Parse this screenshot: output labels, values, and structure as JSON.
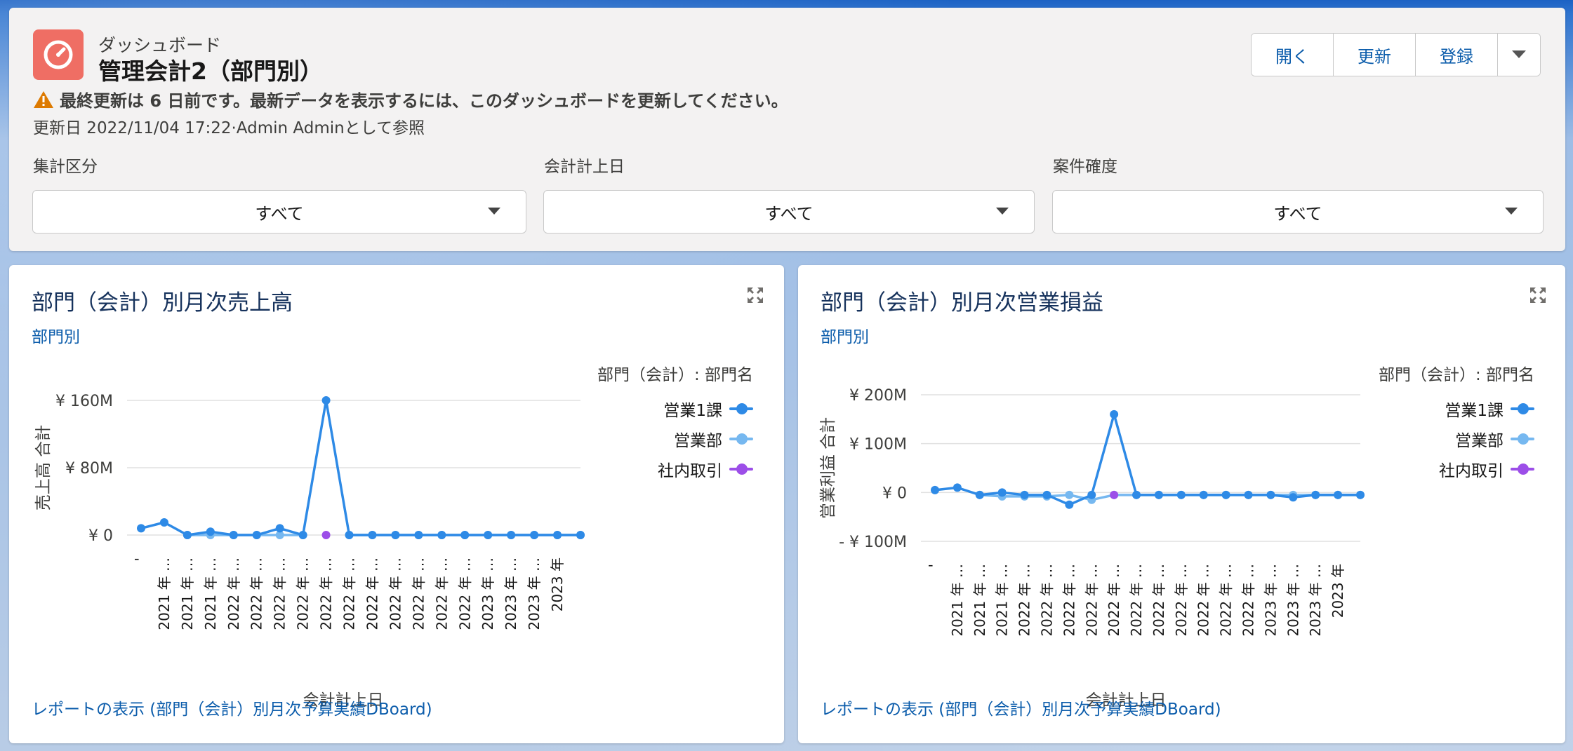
{
  "header": {
    "eyebrow": "ダッシュボード",
    "title": "管理会計2（部門別）",
    "warning": "最終更新は 6 日前です。最新データを表示するには、このダッシュボードを更新してください。",
    "updated": "更新日 2022/11/04 17:22·Admin Adminとして参照",
    "buttons": {
      "open": "開く",
      "refresh": "更新",
      "subscribe": "登録"
    },
    "icon": "dashboard-gauge-icon",
    "icon_color": "#ef6e64"
  },
  "filters": [
    {
      "label": "集計区分",
      "value": "すべて"
    },
    {
      "label": "会計計上日",
      "value": "すべて"
    },
    {
      "label": "案件確度",
      "value": "すべて"
    }
  ],
  "panels": [
    {
      "title": "部門（会計）別月次売上高",
      "subtitle": "部門別",
      "legend_title": "部門（会計）: 部門名",
      "legend": [
        "営業1課",
        "営業部",
        "社内取引"
      ],
      "yticks": [
        "¥ 160M",
        "¥ 80M",
        "¥ 0"
      ],
      "ylabel": "売上高 合計",
      "xlabel": "会計計上日",
      "first_xtick": "'",
      "xticks": [
        "2021 年 …",
        "2021 年 …",
        "2021 年 …",
        "2022 年 …",
        "2022 年 …",
        "2022 年 …",
        "2022 年 …",
        "2022 年 …",
        "2022 年 …",
        "2022 年 …",
        "2022 年 …",
        "2022 年 …",
        "2022 年 …",
        "2022 年 …",
        "2023 年 …",
        "2023 年 …",
        "2023 年 …",
        "2023 年"
      ],
      "report_link": "レポートの表示 (部門（会計）別月次予算実績DBoard)"
    },
    {
      "title": "部門（会計）別月次営業損益",
      "subtitle": "部門別",
      "legend_title": "部門（会計）: 部門名",
      "legend": [
        "営業1課",
        "営業部",
        "社内取引"
      ],
      "yticks": [
        "¥ 200M",
        "¥ 100M",
        "¥ 0",
        "- ¥ 100M"
      ],
      "ylabel": "営業利益 合計",
      "xlabel": "会計計上日",
      "first_xtick": "'",
      "xticks": [
        "2021 年 …",
        "2021 年 …",
        "2021 年 …",
        "2022 年 …",
        "2022 年 …",
        "2022 年 …",
        "2022 年 …",
        "2022 年 …",
        "2022 年 …",
        "2022 年 …",
        "2022 年 …",
        "2022 年 …",
        "2022 年 …",
        "2022 年 …",
        "2023 年 …",
        "2023 年 …",
        "2023 年 …",
        "2023 年"
      ],
      "report_link": "レポートの表示 (部門（会計）別月次予算実績DBoard)"
    }
  ],
  "colors": {
    "series1": "#2e8ae6",
    "series2": "#76b8f0",
    "series3": "#9c4ee8",
    "link": "#0b5cab"
  },
  "chart_data": [
    {
      "type": "line",
      "ylim": [
        0,
        160
      ],
      "unit": "M",
      "x_count": 20,
      "series": [
        {
          "name": "営業1課",
          "color": "#2e8ae6",
          "values": [
            8,
            15,
            0,
            4,
            0,
            0,
            8,
            0,
            160,
            0,
            0,
            0,
            0,
            0,
            0,
            0,
            0,
            0,
            0,
            0
          ]
        },
        {
          "name": "営業部",
          "color": "#76b8f0",
          "values": [
            null,
            null,
            0,
            0,
            0,
            0,
            0,
            0,
            null,
            0,
            0,
            0,
            0,
            0,
            0,
            0,
            0,
            0,
            0,
            0
          ]
        },
        {
          "name": "社内取引",
          "color": "#9c4ee8",
          "values": [
            null,
            null,
            null,
            null,
            null,
            null,
            null,
            null,
            0,
            null,
            null,
            null,
            null,
            null,
            null,
            null,
            null,
            null,
            null,
            null
          ]
        }
      ]
    },
    {
      "type": "line",
      "ylim": [
        -100,
        200
      ],
      "unit": "M",
      "x_count": 20,
      "series": [
        {
          "name": "営業1課",
          "color": "#2e8ae6",
          "values": [
            5,
            10,
            -5,
            0,
            -5,
            -5,
            -25,
            -5,
            160,
            -5,
            -5,
            -5,
            -5,
            -5,
            -5,
            -5,
            -10,
            -5,
            -5,
            -5
          ]
        },
        {
          "name": "営業部",
          "color": "#76b8f0",
          "values": [
            null,
            null,
            -5,
            -8,
            -8,
            -8,
            -5,
            -15,
            -5,
            -5,
            -5,
            -5,
            -5,
            -5,
            -5,
            -5,
            -5,
            -5,
            -5,
            -5
          ]
        },
        {
          "name": "社内取引",
          "color": "#9c4ee8",
          "values": [
            null,
            null,
            null,
            null,
            null,
            null,
            null,
            null,
            -5,
            null,
            null,
            null,
            null,
            null,
            null,
            null,
            null,
            null,
            null,
            null
          ]
        }
      ]
    }
  ]
}
